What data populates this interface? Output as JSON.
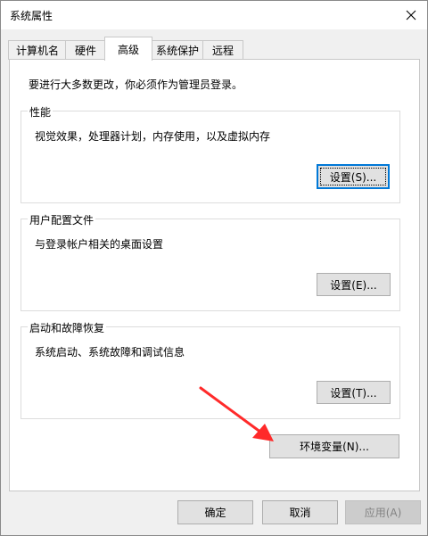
{
  "window": {
    "title": "系统属性"
  },
  "tabs": [
    {
      "label": "计算机名"
    },
    {
      "label": "硬件"
    },
    {
      "label": "高级"
    },
    {
      "label": "系统保护"
    },
    {
      "label": "远程"
    }
  ],
  "active_tab": "高级",
  "admin_note": "要进行大多数更改，你必须作为管理员登录。",
  "groups": {
    "performance": {
      "title": "性能",
      "description": "视觉效果，处理器计划，内存使用，以及虚拟内存",
      "button_label": "设置(S)..."
    },
    "user_profiles": {
      "title": "用户配置文件",
      "description": "与登录帐户相关的桌面设置",
      "button_label": "设置(E)..."
    },
    "startup_recovery": {
      "title": "启动和故障恢复",
      "description": "系统启动、系统故障和调试信息",
      "button_label": "设置(T)..."
    }
  },
  "env_button_label": "环境变量(N)...",
  "footer": {
    "ok_label": "确定",
    "cancel_label": "取消",
    "apply_label": "应用(A)"
  },
  "annotation": {
    "arrow_color": "#ff2a2a"
  }
}
